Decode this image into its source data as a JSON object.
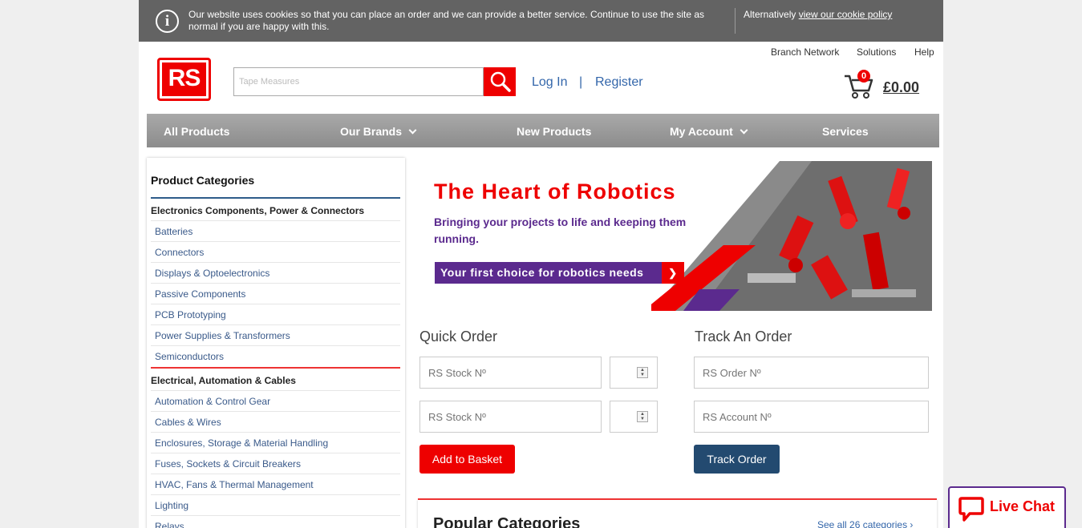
{
  "cookie": {
    "message": "Our website uses cookies so that you can place an order and we can provide a better service. Continue to use the site as normal if you are happy with this.",
    "alt_prefix": "Alternatively ",
    "alt_link": "view our cookie policy",
    "info_glyph": "i"
  },
  "header": {
    "top_links": [
      "Branch Network",
      "Solutions",
      "Help"
    ],
    "logo_text": "RS",
    "search_value": "Tape Measures",
    "login": "Log In",
    "separator": "|",
    "register": "Register",
    "cart_count": "0",
    "cart_total": "£0.00"
  },
  "nav": {
    "items": [
      "All Products",
      "Our Brands",
      "New Products",
      "My Account",
      "Services"
    ]
  },
  "sidebar": {
    "title": "Product Categories",
    "group1": "Electronics Components, Power & Connectors",
    "group1_items": [
      "Batteries",
      "Connectors",
      "Displays & Optoelectronics",
      "Passive Components",
      "PCB Prototyping",
      "Power Supplies & Transformers",
      "Semiconductors"
    ],
    "group2": "Electrical, Automation & Cables",
    "group2_items": [
      "Automation & Control Gear",
      "Cables & Wires",
      "Enclosures, Storage & Material Handling",
      "Fuses, Sockets & Circuit Breakers",
      "HVAC, Fans & Thermal Management",
      "Lighting",
      "Relays"
    ]
  },
  "banner": {
    "title": "The Heart of Robotics",
    "subtitle": "Bringing your projects to life and keeping them running.",
    "cta": "Your first choice for robotics needs",
    "cta_arrow": "❯"
  },
  "quick_order": {
    "title": "Quick Order",
    "stock_placeholder": "RS Stock Nº",
    "button": "Add to Basket"
  },
  "track_order": {
    "title": "Track An Order",
    "order_placeholder": "RS Order Nº",
    "account_placeholder": "RS Account Nº",
    "button": "Track Order"
  },
  "popular": {
    "title": "Popular Categories",
    "link": "See all 26 categories ›"
  },
  "livechat": {
    "label": "Live Chat"
  },
  "colors": {
    "brand_red": "#ee0000",
    "brand_purple": "#5b2a8e",
    "track_blue": "#234a70"
  }
}
